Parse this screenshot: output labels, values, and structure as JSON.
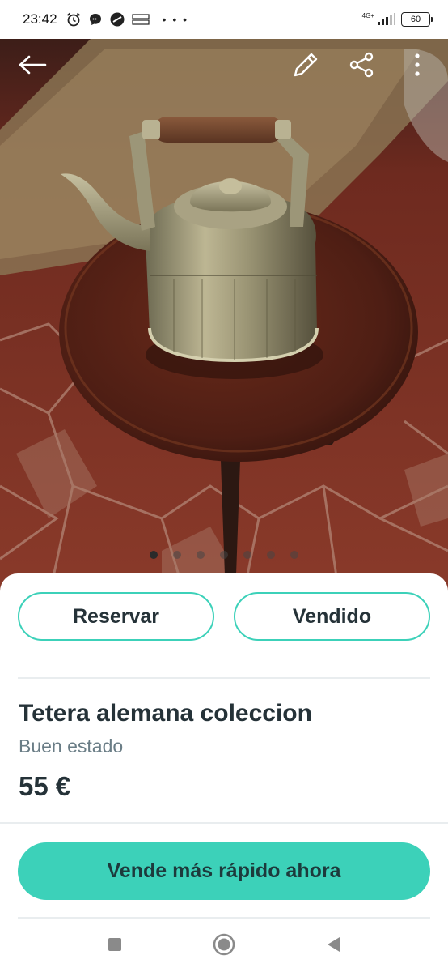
{
  "status_bar": {
    "time": "23:42",
    "network_label": "4G+",
    "battery": "60",
    "more_indicator": "• • •"
  },
  "toolbar": {
    "back_icon": "arrow-left-icon",
    "edit_icon": "pencil-icon",
    "share_icon": "share-icon",
    "more_icon": "more-vertical-icon"
  },
  "gallery": {
    "image_count": 7,
    "active_index": 0
  },
  "actions": {
    "reserve_label": "Reservar",
    "sold_label": "Vendido"
  },
  "listing": {
    "title": "Tetera alemana coleccion",
    "condition": "Buen estado",
    "price": "55 €"
  },
  "cta": {
    "label": "Vende más rápido ahora"
  },
  "system_nav": {
    "recents_icon": "square-icon",
    "home_icon": "circle-icon",
    "back_icon": "triangle-back-icon"
  },
  "colors": {
    "accent": "#3cd1b9",
    "text_dark": "#253238",
    "text_muted": "#6a7d86"
  }
}
